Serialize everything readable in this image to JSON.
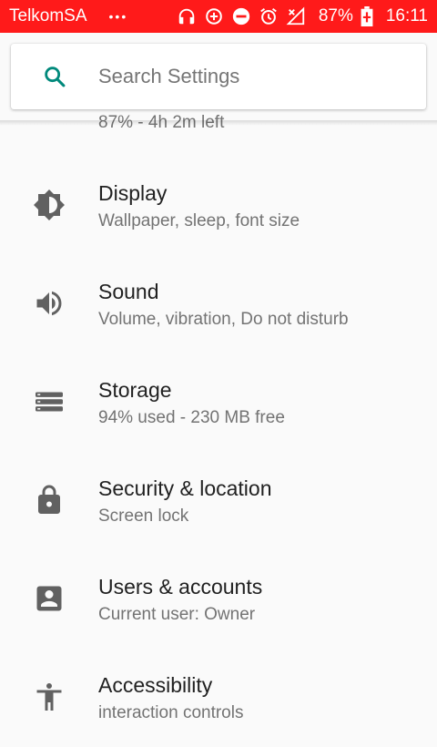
{
  "status_bar": {
    "carrier": "TelkomSA",
    "overflow": "•••",
    "battery_percent": "87%",
    "time": "16:11",
    "background_color": "#ff1a1a",
    "icons": [
      "headphones-icon",
      "data-saver-icon",
      "do-not-disturb-icon",
      "alarm-icon",
      "no-signal-icon",
      "battery-charging-icon"
    ]
  },
  "search": {
    "placeholder": "Search Settings",
    "accent_color": "#00897b"
  },
  "battery_partial_summary": "87% - 4h 2m left",
  "items": [
    {
      "title": "Display",
      "summary": "Wallpaper, sleep, font size",
      "icon": "brightness-icon"
    },
    {
      "title": "Sound",
      "summary": "Volume, vibration, Do not disturb",
      "icon": "volume-icon"
    },
    {
      "title": "Storage",
      "summary": "94% used - 230 MB free",
      "icon": "storage-icon"
    },
    {
      "title": "Security & location",
      "summary": "Screen lock",
      "icon": "lock-icon"
    },
    {
      "title": "Users & accounts",
      "summary": "Current user: Owner",
      "icon": "account-box-icon"
    },
    {
      "title": "Accessibility",
      "summary": "interaction controls",
      "icon": "accessibility-icon"
    }
  ]
}
